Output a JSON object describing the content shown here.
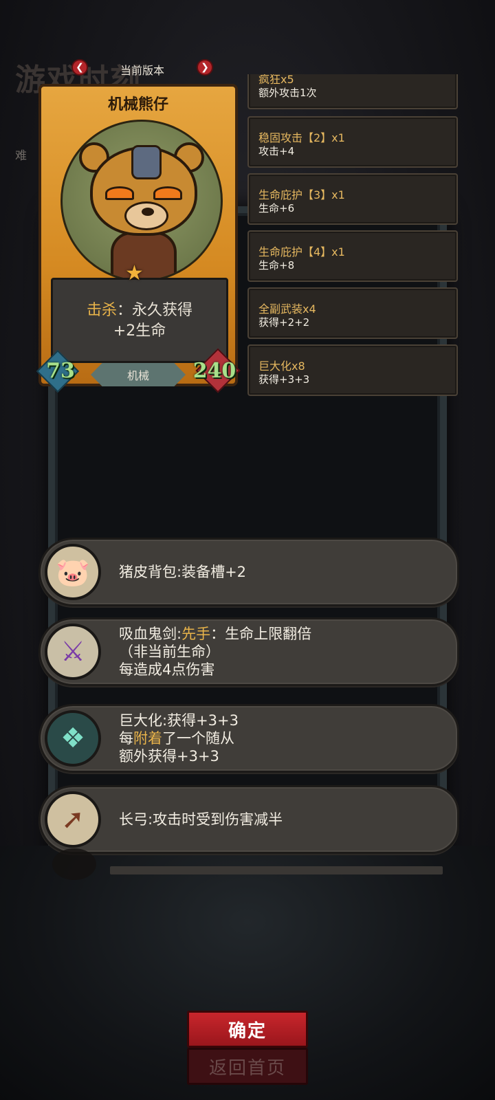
{
  "background": {
    "title": "游戏时刻",
    "subtitle": "难"
  },
  "version": {
    "label": "当前版本",
    "prev_icon": "chevron-left-icon",
    "next_icon": "chevron-right-icon"
  },
  "card": {
    "name": "机械熊仔",
    "ability_keyword": "击杀",
    "ability_line1": "：永久获得",
    "ability_line2": "+2生命",
    "attack": "73",
    "health": "240",
    "tribe": "机械"
  },
  "buffs": [
    {
      "name": "疯狂x5",
      "effect": "额外攻击1次"
    },
    {
      "name": "稳固攻击【2】x1",
      "effect": "攻击+4"
    },
    {
      "name": "生命庇护【3】x1",
      "effect": "生命+6"
    },
    {
      "name": "生命庇护【4】x1",
      "effect": "生命+8"
    },
    {
      "name": "全副武装x4",
      "effect": "获得+2+2"
    },
    {
      "name": "巨大化x8",
      "effect": "获得+3+3"
    }
  ],
  "items": [
    {
      "icon": "pig-backpack-icon",
      "line1": "猪皮背包:装备槽+2"
    },
    {
      "icon": "vampire-sword-icon",
      "line1_pre": "吸血鬼剑:",
      "line1_hl": "先手",
      "line1_post": "：生命上限翻倍",
      "line2": "（非当前生命）",
      "line3": "每造成4点伤害"
    },
    {
      "icon": "giant-claw-icon",
      "line1": "巨大化:获得+3+3",
      "line2_pre": "每",
      "line2_hl": "附着",
      "line2_post": "了一个随从",
      "line3": "额外获得+3+3"
    },
    {
      "icon": "longbow-icon",
      "line1": "长弓:攻击时受到伤害减半"
    }
  ],
  "buttons": {
    "confirm": "确定",
    "home": "返回首页"
  },
  "colors": {
    "accent_red": "#c8262c",
    "highlight_gold": "#e9b44a",
    "stat_green": "#a8e08a"
  }
}
